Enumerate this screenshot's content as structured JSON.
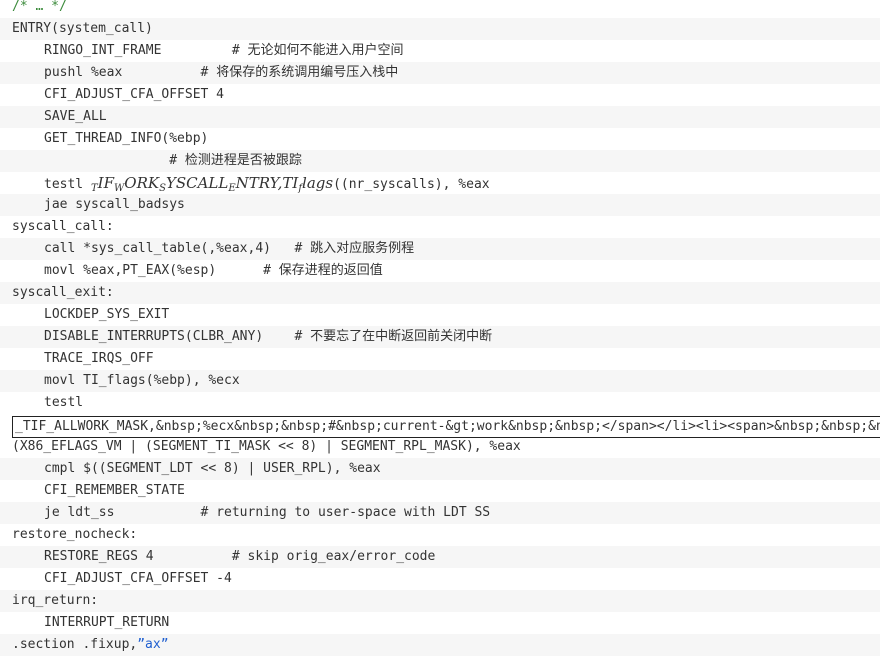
{
  "lines": [
    {
      "indent": 0,
      "code": "/* … */",
      "type": "comment"
    },
    {
      "indent": 0,
      "code": "ENTRY(system_call)"
    },
    {
      "indent": 1,
      "code": "RINGO_INT_FRAME         ",
      "comment": "# 无论如何不能进入用户空间"
    },
    {
      "indent": 1,
      "code": "pushl %eax          ",
      "comment": "# 将保存的系统调用编号压入栈中"
    },
    {
      "indent": 1,
      "code": "CFI_ADJUST_CFA_OFFSET 4"
    },
    {
      "indent": 1,
      "code": "SAVE_ALL"
    },
    {
      "indent": 1,
      "code": "GET_THREAD_INFO(%ebp)"
    },
    {
      "indent": 1,
      "code": "                ",
      "comment": "# 检测进程是否被跟踪"
    },
    {
      "indent": 1,
      "code_prefix": "testl ",
      "math": {
        "pre": "T",
        "parts": [
          [
            "IF",
            "W"
          ],
          [
            "ORK",
            "S"
          ],
          [
            "YSCALL",
            "E"
          ],
          [
            "NTRY,TI",
            "f"
          ],
          [
            "lags",
            ""
          ]
        ]
      },
      "code_suffix": "((nr_syscalls), %eax"
    },
    {
      "indent": 1,
      "code": "jae syscall_badsys"
    },
    {
      "indent": 0,
      "code": "syscall_call:"
    },
    {
      "indent": 1,
      "code": "call *sys_call_table(,%eax,4)   ",
      "comment": "# 跳入对应服务例程"
    },
    {
      "indent": 1,
      "code": "movl %eax,PT_EAX(%esp)      ",
      "comment": "# 保存进程的返回值"
    },
    {
      "indent": 0,
      "code": "syscall_exit:"
    },
    {
      "indent": 1,
      "code": "LOCKDEP_SYS_EXIT"
    },
    {
      "indent": 1,
      "code": "DISABLE_INTERRUPTS(CLBR_ANY)    ",
      "comment": "# 不要忘了在中断返回前关闭中断"
    },
    {
      "indent": 1,
      "code": "TRACE_IRQS_OFF"
    },
    {
      "indent": 1,
      "code": "movl TI_flags(%ebp), %ecx"
    },
    {
      "indent": 1,
      "code": "testl"
    },
    {
      "indent": 0,
      "code": "",
      "boxed": "_TIF_ALLWORK_MASK,&nbsp;%ecx&nbsp;&nbsp;#&nbsp;current-&gt;work&nbsp;&nbsp;</span></li><li><span>&nbsp;&nbsp;&nbsp;&nbsp;"
    },
    {
      "indent": 0,
      "code": "(X86_EFLAGS_VM | (SEGMENT_TI_MASK << 8) | SEGMENT_RPL_MASK), %eax"
    },
    {
      "indent": 1,
      "code": "cmpl $((SEGMENT_LDT << 8) | USER_RPL), %eax"
    },
    {
      "indent": 1,
      "code": "CFI_REMEMBER_STATE"
    },
    {
      "indent": 1,
      "code": "je ldt_ss           ",
      "comment": "# returning to user-space with LDT SS",
      "comment_plain": true
    },
    {
      "indent": 0,
      "code": "restore_nocheck:"
    },
    {
      "indent": 1,
      "code": "RESTORE_REGS 4          ",
      "comment": "# skip orig_eax/error_code",
      "comment_plain": true
    },
    {
      "indent": 1,
      "code": "CFI_ADJUST_CFA_OFFSET -4"
    },
    {
      "indent": 0,
      "code": "irq_return:"
    },
    {
      "indent": 1,
      "code": "INTERRUPT_RETURN"
    },
    {
      "indent": 0,
      "code": ".section .fixup,",
      "string": "”ax”"
    }
  ],
  "colors": {
    "comment": "#3a8a3a",
    "text": "#333333",
    "string": "#1f5fd0",
    "stripe": "#f6f6f6"
  }
}
